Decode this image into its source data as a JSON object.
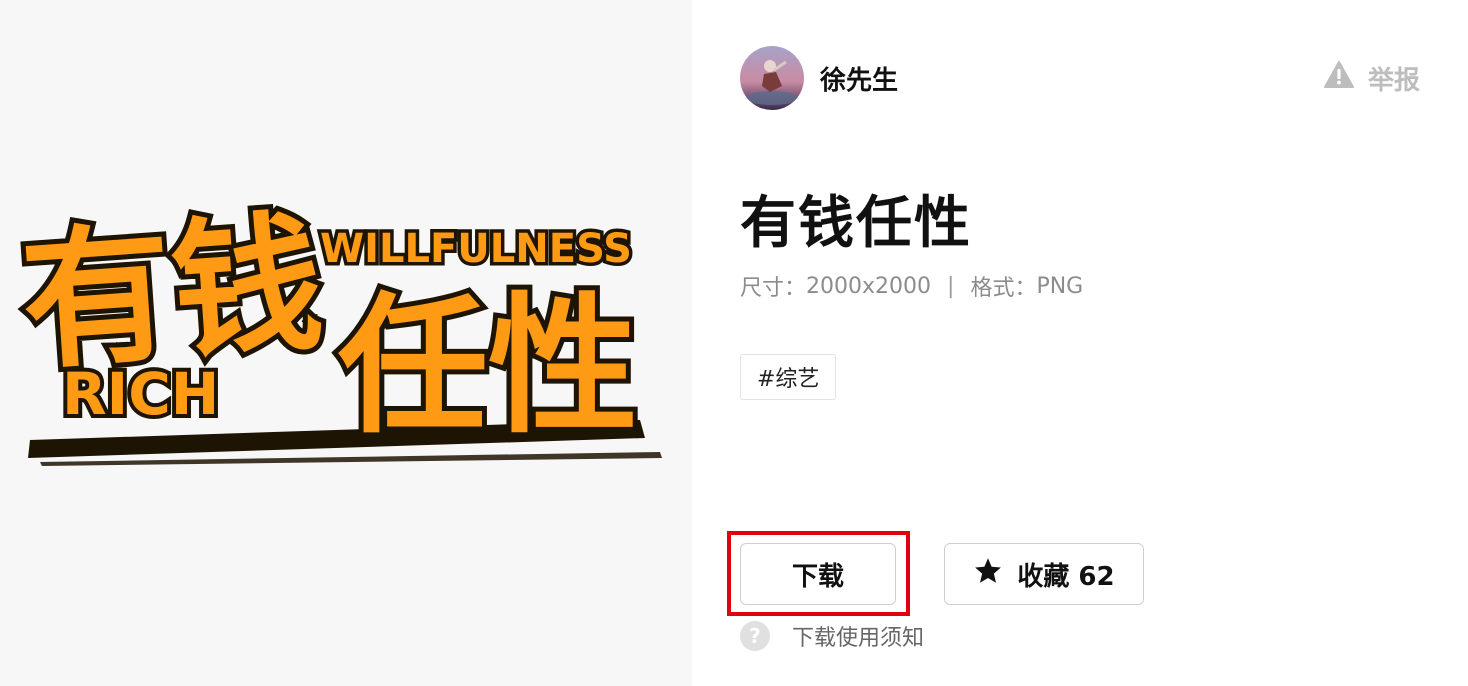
{
  "preview": {
    "art_text_main_1": "有钱",
    "art_text_main_2": "任性",
    "art_text_top": "WILLFULNESS",
    "art_text_bottom": "RICH",
    "art_fill_color": "#ff9a14",
    "art_outline_color": "#1e1404"
  },
  "author": {
    "name": "徐先生"
  },
  "report": {
    "label": "举报",
    "icon": "warning-triangle-icon"
  },
  "asset": {
    "title": "有钱任性",
    "size_label": "尺寸：",
    "size_value": "2000x2000",
    "separator": "|",
    "format_label": "格式：",
    "format_value": "PNG",
    "tag": "#综艺"
  },
  "actions": {
    "download_label": "下载",
    "favorite_label": "收藏 62",
    "favorite_icon": "star-icon",
    "help_label": "下载使用须知",
    "help_icon": "question-circle-icon"
  },
  "colors": {
    "highlight": "#e00012",
    "panel_bg": "#f7f7f7",
    "muted_text": "#8c8c8c"
  }
}
